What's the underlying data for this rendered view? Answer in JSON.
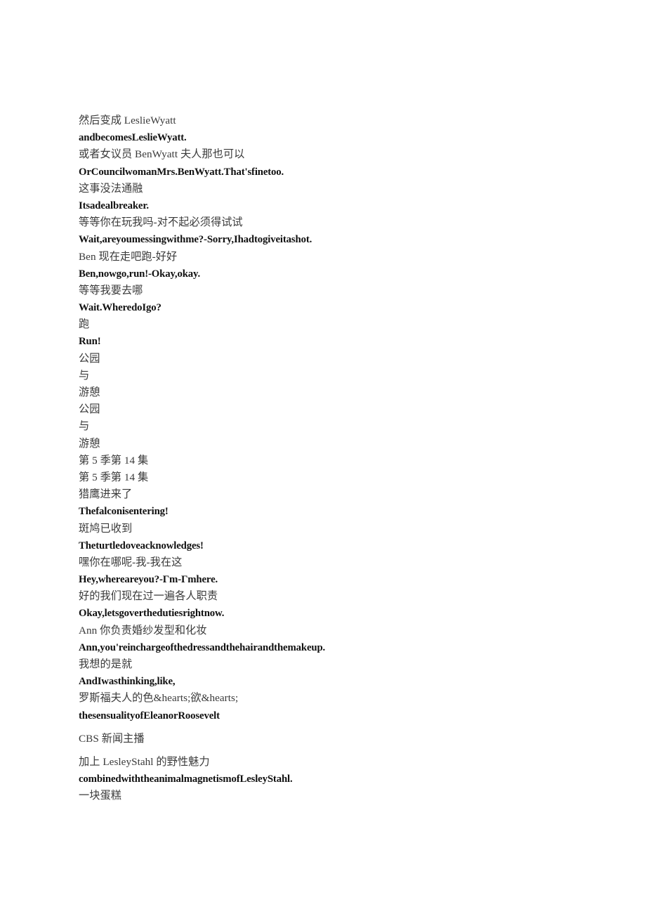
{
  "document": {
    "type": "bilingual-subtitle-transcript",
    "background_color": "#ffffff",
    "zh_text_color": "#3a3a3a",
    "en_text_color": "#111111",
    "lines": [
      {
        "lang": "zh",
        "text": "然后变成 LeslieWyatt"
      },
      {
        "lang": "en",
        "text": "andbecomesLeslieWyatt."
      },
      {
        "lang": "zh",
        "text": "或者女议员 BenWyatt 夫人那也可以"
      },
      {
        "lang": "en",
        "text": "OrCouncilwomanMrs.BenWyatt.That'sfinetoo."
      },
      {
        "lang": "zh",
        "text": "这事没法通融"
      },
      {
        "lang": "en",
        "text": "Itsadealbreaker."
      },
      {
        "lang": "zh",
        "text": "等等你在玩我吗-对不起必须得试试"
      },
      {
        "lang": "en",
        "text": "Wait,areyoumessingwithme?-Sorry,Ihadtogiveitashot."
      },
      {
        "lang": "zh",
        "text": "Ben 现在走吧跑-好好"
      },
      {
        "lang": "en",
        "text": "Ben,nowgo,run!-Okay,okay."
      },
      {
        "lang": "zh",
        "text": "等等我要去哪"
      },
      {
        "lang": "en",
        "text": "Wait.WheredoIgo?"
      },
      {
        "lang": "zh",
        "text": "跑"
      },
      {
        "lang": "en",
        "text": "Run!"
      },
      {
        "lang": "zh",
        "text": "公园"
      },
      {
        "lang": "zh",
        "text": "与"
      },
      {
        "lang": "zh",
        "text": "游憩"
      },
      {
        "lang": "zh",
        "text": "公园"
      },
      {
        "lang": "zh",
        "text": "与"
      },
      {
        "lang": "zh",
        "text": "游憩"
      },
      {
        "lang": "zh",
        "text": "第 5 季第 14 集"
      },
      {
        "lang": "zh",
        "text": "第 5 季第 14 集"
      },
      {
        "lang": "zh",
        "text": "猎鹰进来了"
      },
      {
        "lang": "en",
        "text": "Thefalconisentering!"
      },
      {
        "lang": "zh",
        "text": "斑鸠已收到"
      },
      {
        "lang": "en",
        "text": "Theturtledoveacknowledges!"
      },
      {
        "lang": "zh",
        "text": "嘿你在哪呢-我-我在这"
      },
      {
        "lang": "en",
        "text": "Hey,whereareyou?-Γm-Γmhere."
      },
      {
        "lang": "zh",
        "text": "好的我们现在过一遍各人职责"
      },
      {
        "lang": "en",
        "text": "Okay,letsgoverthedutiesrightnow."
      },
      {
        "lang": "zh",
        "text": "Ann 你负责婚纱发型和化妆"
      },
      {
        "lang": "en",
        "text": "Ann,you'reinchargeofthedressandthehairandthemakeup."
      },
      {
        "lang": "zh",
        "text": "我想的是就"
      },
      {
        "lang": "en",
        "text": "AndIwasthinking,like,"
      },
      {
        "lang": "zh",
        "text": "罗斯福夫人的色&hearts;欲&hearts;"
      },
      {
        "lang": "en",
        "text": "thesensualityofEleanorRoosevelt"
      },
      {
        "lang": "zh",
        "text": "CBS 新闻主播",
        "spacing": "gap-after"
      },
      {
        "lang": "zh",
        "text": "加上 LesleyStahl 的野性魅力"
      },
      {
        "lang": "en",
        "text": "combinedwiththeanimalmagnetismofLesleyStahl."
      },
      {
        "lang": "zh",
        "text": "一块蛋糕"
      }
    ]
  }
}
